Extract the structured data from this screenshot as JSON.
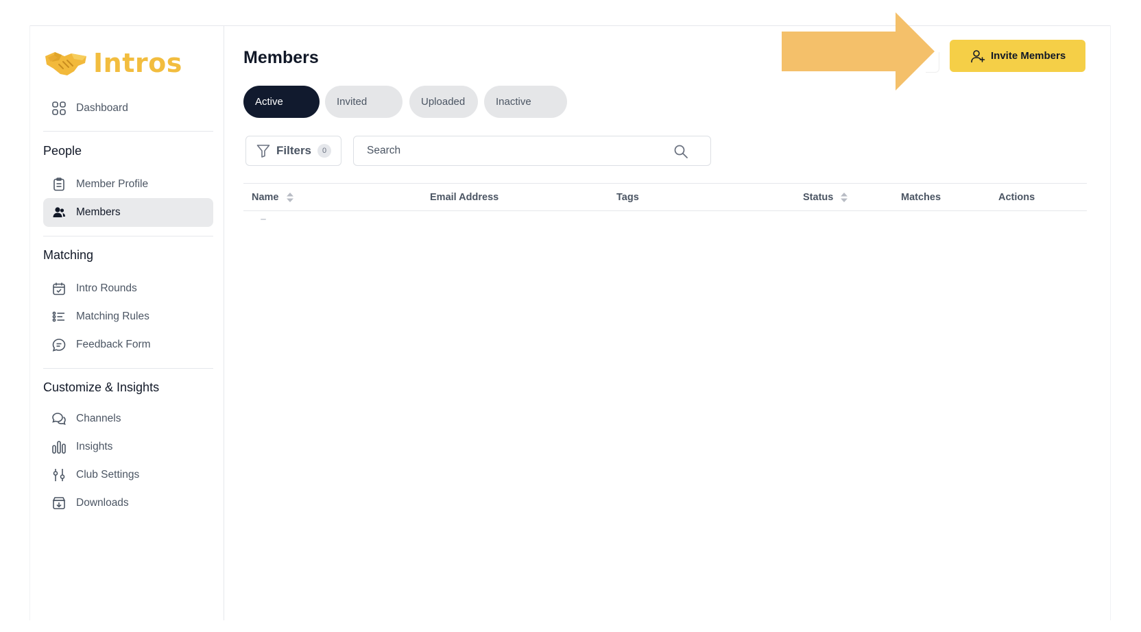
{
  "app": {
    "name": "Intros"
  },
  "sidebar": {
    "top_items": [
      {
        "label": "Dashboard",
        "icon": "grid-icon"
      }
    ],
    "sections": [
      {
        "title": "People",
        "items": [
          {
            "label": "Member Profile",
            "icon": "clipboard-icon",
            "active": false
          },
          {
            "label": "Members",
            "icon": "users-icon",
            "active": true
          }
        ]
      },
      {
        "title": "Matching",
        "items": [
          {
            "label": "Intro Rounds",
            "icon": "calendar-check-icon",
            "active": false
          },
          {
            "label": "Matching Rules",
            "icon": "list-icon",
            "active": false
          },
          {
            "label": "Feedback Form",
            "icon": "message-icon",
            "active": false
          }
        ]
      },
      {
        "title": "Customize & Insights",
        "items": [
          {
            "label": "Channels",
            "icon": "chat-icon",
            "active": false
          },
          {
            "label": "Insights",
            "icon": "bar-chart-icon",
            "active": false
          },
          {
            "label": "Club Settings",
            "icon": "sliders-icon",
            "active": false
          },
          {
            "label": "Downloads",
            "icon": "download-box-icon",
            "active": false
          }
        ]
      }
    ]
  },
  "main": {
    "title": "Members",
    "invite_button": {
      "label": "Invite Members"
    },
    "tabs": [
      {
        "label": "Active",
        "active": true
      },
      {
        "label": "Invited",
        "active": false
      },
      {
        "label": "Uploaded",
        "active": false
      },
      {
        "label": "Inactive",
        "active": false
      }
    ],
    "filters": {
      "label": "Filters",
      "count": "0"
    },
    "search": {
      "placeholder": "Search",
      "value": ""
    },
    "table": {
      "columns": [
        {
          "label": "Name",
          "sortable": true
        },
        {
          "label": "Email Address",
          "sortable": false
        },
        {
          "label": "Tags",
          "sortable": false
        },
        {
          "label": "Status",
          "sortable": true
        },
        {
          "label": "Matches",
          "sortable": false
        },
        {
          "label": "Actions",
          "sortable": false
        }
      ],
      "rows": []
    }
  },
  "colors": {
    "accent": "#f5cf47",
    "brand": "#f2bd3f",
    "active_tab": "#111a2e",
    "annotation_arrow": "#f4c06a"
  }
}
